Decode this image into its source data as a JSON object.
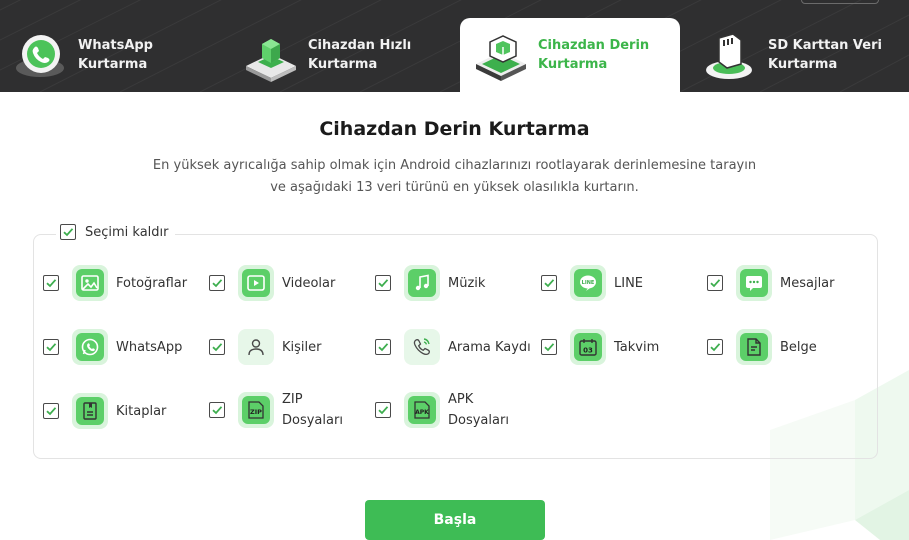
{
  "tabs": [
    {
      "label": "WhatsApp\nKurtarma",
      "icon": "whatsapp-phone-icon",
      "active": false
    },
    {
      "label": "Cihazdan Hızlı\nKurtarma",
      "icon": "device-quick-icon",
      "active": false
    },
    {
      "label": "Cihazdan Derin\nKurtarma",
      "icon": "device-deep-icon",
      "active": true
    },
    {
      "label": "SD Karttan Veri\nKurtarma",
      "icon": "sd-card-icon",
      "active": false
    }
  ],
  "main": {
    "title": "Cihazdan Derin Kurtarma",
    "subtitle": "En yüksek ayrıcalığa sahip olmak için Android cihazlarınızı rootlayarak derinlemesine tarayın ve aşağıdaki 13 veri türünü en yüksek olasılıkla kurtarın."
  },
  "select_all": {
    "label": "Seçimi kaldır",
    "checked": true
  },
  "data_types": [
    {
      "label": "Fotoğraflar",
      "icon": "photo-icon",
      "checked": true
    },
    {
      "label": "Videolar",
      "icon": "video-icon",
      "checked": true
    },
    {
      "label": "Müzik",
      "icon": "music-icon",
      "checked": true
    },
    {
      "label": "LINE",
      "icon": "line-icon",
      "checked": true
    },
    {
      "label": "Mesajlar",
      "icon": "message-icon",
      "checked": true
    },
    {
      "label": "WhatsApp",
      "icon": "whatsapp-icon",
      "checked": true
    },
    {
      "label": "Kişiler",
      "icon": "contact-icon",
      "checked": true
    },
    {
      "label": "Arama Kaydı",
      "icon": "call-log-icon",
      "checked": true
    },
    {
      "label": "Takvim",
      "icon": "calendar-icon",
      "checked": true,
      "icon_text": "03"
    },
    {
      "label": "Belge",
      "icon": "document-icon",
      "checked": true
    },
    {
      "label": "Kitaplar",
      "icon": "book-icon",
      "checked": true
    },
    {
      "label": "ZIP\nDosyaları",
      "icon": "zip-icon",
      "checked": true,
      "icon_text": "ZIP"
    },
    {
      "label": "APK\nDosyaları",
      "icon": "apk-icon",
      "checked": true,
      "icon_text": "APK"
    }
  ],
  "start_button": {
    "label": "Başla"
  },
  "colors": {
    "accent": "#3ebc55",
    "topbar": "#2f2f30",
    "icon_bg": "#d9f4dc"
  }
}
